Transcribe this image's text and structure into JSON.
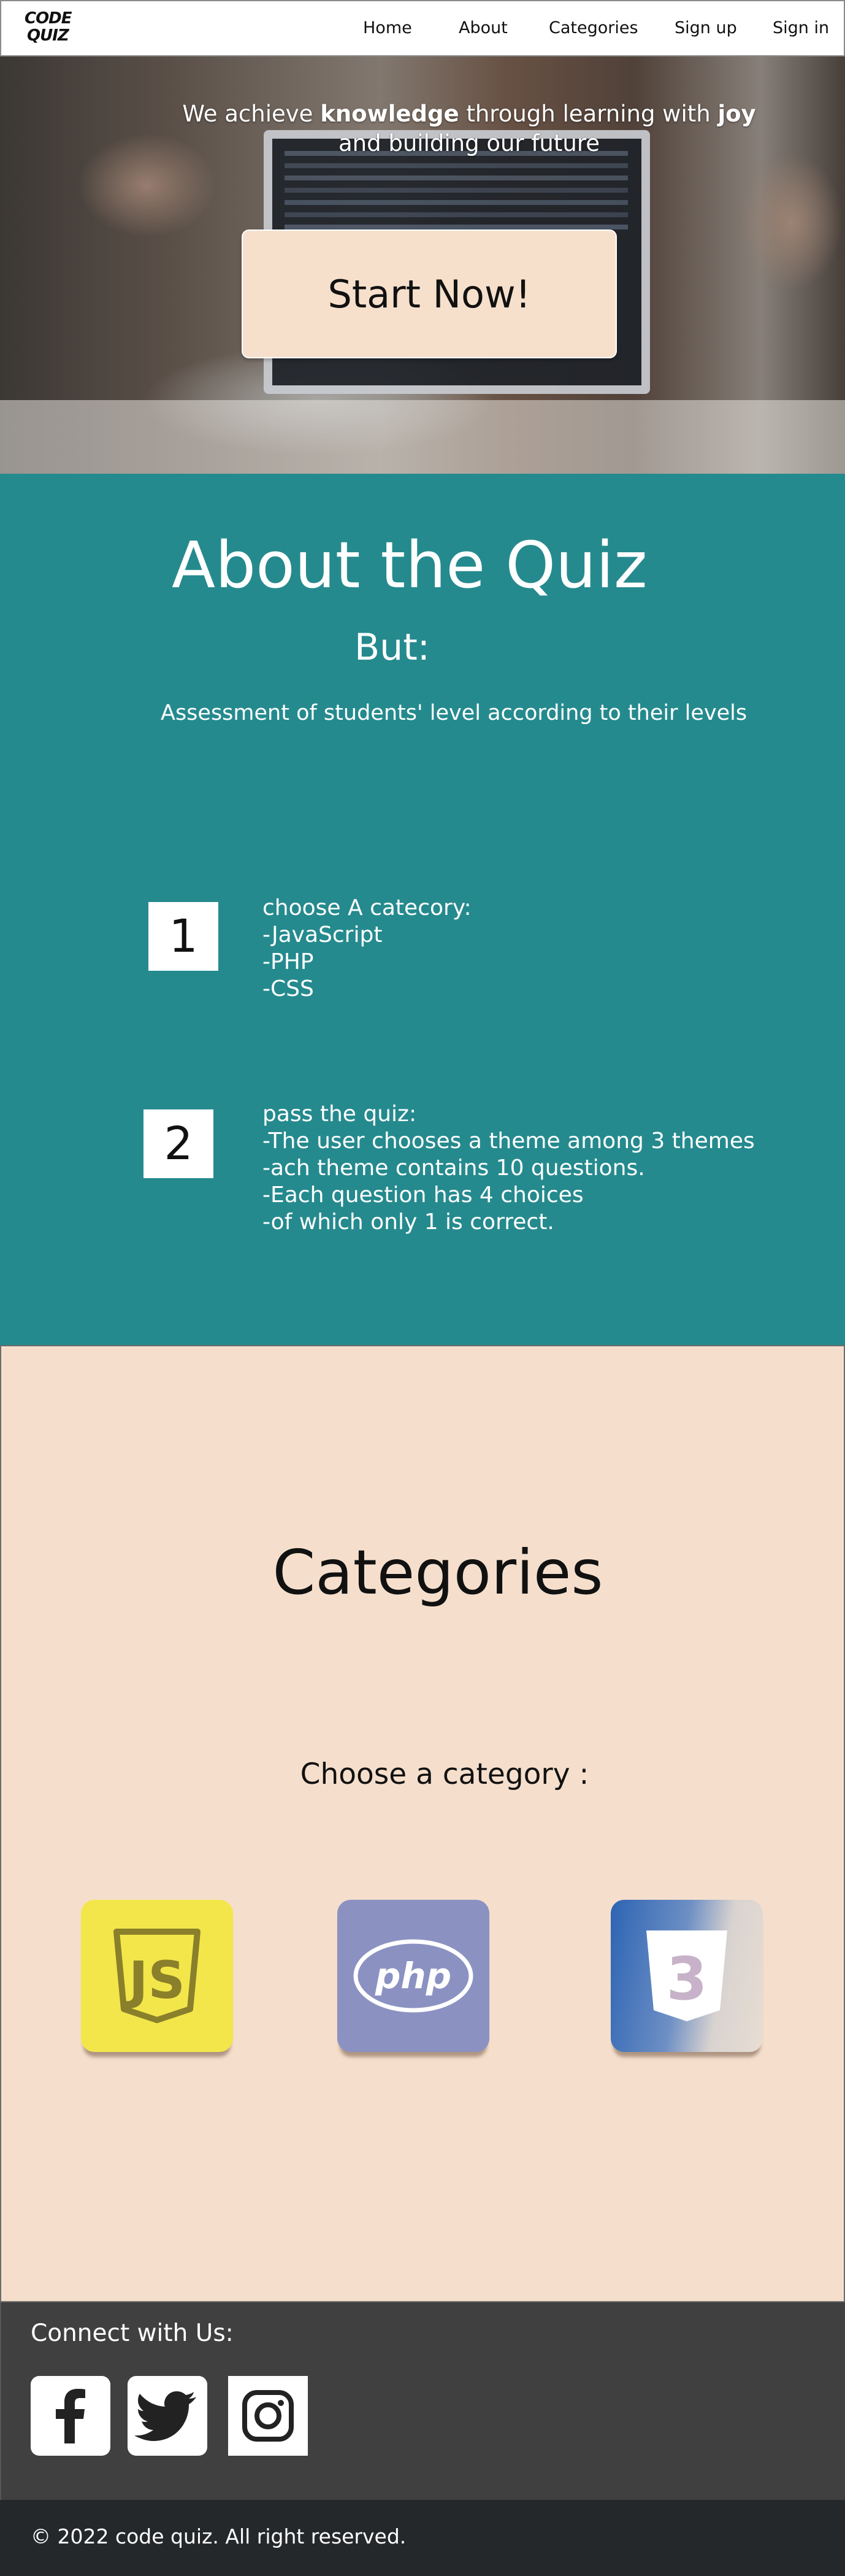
{
  "nav": {
    "logo_line1": "CODE",
    "logo_line2": "QUIZ",
    "links": [
      "Home",
      "About",
      "Categories",
      "Sign up",
      "Sign in"
    ]
  },
  "hero": {
    "text_part1": "We achieve ",
    "text_bold1": "knowledge",
    "text_part2": " through learning with ",
    "text_bold2": "joy",
    "text_line2": "and building our future",
    "button_label": "Start Now!"
  },
  "about": {
    "title": "About the Quiz",
    "subtitle": "But:",
    "description": "Assessment of students' level according to their levels",
    "steps": [
      {
        "number": "1",
        "text": "choose A catecory:\n-JavaScript\n-PHP\n-CSS"
      },
      {
        "number": "2",
        "text": "pass the quiz:\n-The user chooses a theme among 3 themes\n-ach theme contains 10 questions.\n-Each question has 4 choices\n-of which only 1 is correct."
      }
    ]
  },
  "categories": {
    "title": "Categories",
    "subtitle": "Choose a category :",
    "items": [
      {
        "icon": "javascript-logo-icon",
        "text": "JS",
        "color": "#f3e64b"
      },
      {
        "icon": "php-logo-icon",
        "text": "php",
        "color": "#8b92c2"
      },
      {
        "icon": "css3-logo-icon",
        "text": "3",
        "color": "#2d64b4"
      }
    ]
  },
  "footer": {
    "connect": "Connect with Us:",
    "socials": [
      "facebook-icon",
      "twitter-icon",
      "instagram-icon"
    ],
    "copyright": "© 2022 code quiz. All right reserved."
  },
  "colors": {
    "about_bg": "#258a8e",
    "categories_bg": "#f5dfcc",
    "button_bg": "#f6e0cc",
    "footer_bg": "#404040",
    "copyright_bg": "#25282b"
  }
}
